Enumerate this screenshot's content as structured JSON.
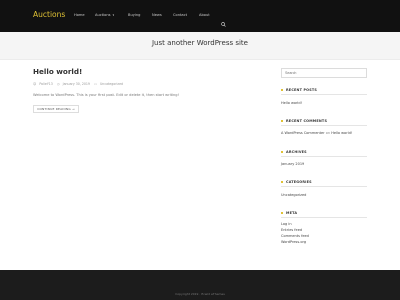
{
  "header": {
    "site_title": "Auctions",
    "nav": [
      {
        "label": "Home"
      },
      {
        "label": "Auctions",
        "has_dropdown": true
      },
      {
        "label": "Buying"
      },
      {
        "label": "News"
      },
      {
        "label": "Contact"
      },
      {
        "label": "About"
      }
    ],
    "search_icon": "search-icon"
  },
  "hero": {
    "tagline": "Just another WordPress site"
  },
  "post": {
    "title": "Hello world!",
    "meta": {
      "author": "PolieY13",
      "date": "January 30, 2019",
      "category": "Uncategorized"
    },
    "excerpt": "Welcome to WordPress. This is your first post. Edit or delete it, then start writing!",
    "continue_label": "CONTINUE READING →"
  },
  "sidebar": {
    "search_placeholder": "Search",
    "recent_posts": {
      "title": "RECENT POSTS",
      "items": [
        "Hello world!"
      ]
    },
    "recent_comments": {
      "title": "RECENT COMMENTS",
      "author": "A WordPress Commenter",
      "connector": "on",
      "post": "Hello world!"
    },
    "archives": {
      "title": "ARCHIVES",
      "items": [
        "January 2019"
      ]
    },
    "categories": {
      "title": "CATEGORIES",
      "items": [
        "Uncategorized"
      ]
    },
    "meta": {
      "title": "META",
      "items": [
        "Log in",
        "Entries feed",
        "Comments feed",
        "WordPress.org"
      ]
    }
  },
  "footer": {
    "text": "Copyright 2019 · Ecwid eThemes"
  },
  "colors": {
    "accent": "#e0c235",
    "topbar": "#111111",
    "footer": "#1c1c1c"
  }
}
